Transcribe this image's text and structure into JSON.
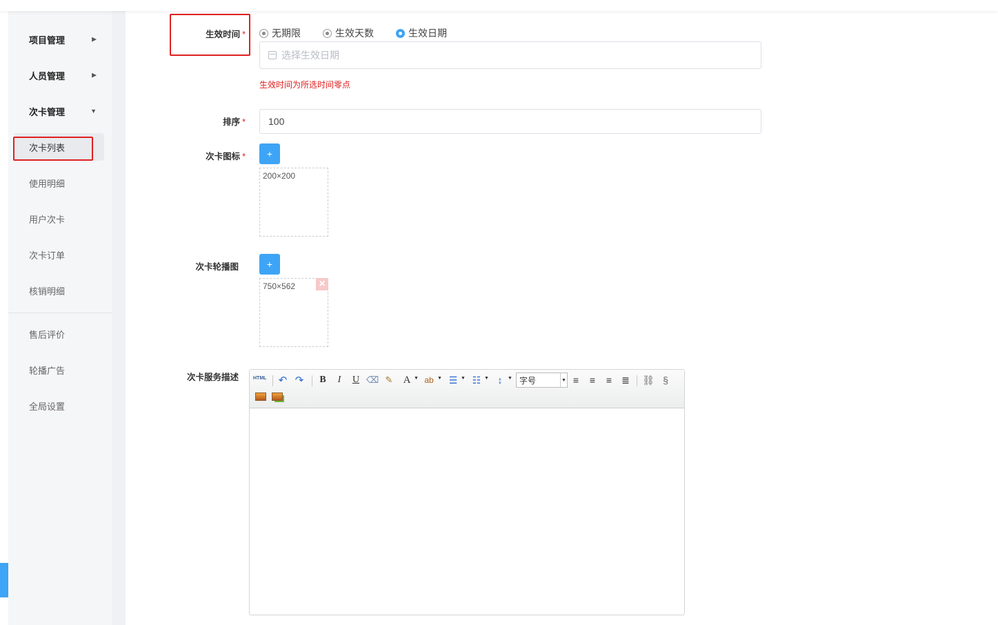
{
  "sidebar": {
    "groups": [
      {
        "label": "项目管理",
        "caret": "▶"
      },
      {
        "label": "人员管理",
        "caret": "▶"
      },
      {
        "label": "次卡管理",
        "caret": "▼"
      }
    ],
    "subitems": [
      "次卡列表",
      "使用明细",
      "用户次卡",
      "次卡订单",
      "核销明细"
    ],
    "items": [
      "售后评价",
      "轮播广告",
      "全局设置"
    ]
  },
  "form": {
    "effective_time": {
      "label": "生效时间",
      "required_mark": "*",
      "options": [
        "无期限",
        "生效天数",
        "生效日期"
      ],
      "selected": "生效日期",
      "date_placeholder": "选择生效日期",
      "hint": "生效时间为所选时间零点"
    },
    "sort": {
      "label": "排序",
      "required_mark": "*",
      "value": "100"
    },
    "icon": {
      "label": "次卡图标",
      "required_mark": "*",
      "add_label": "+",
      "size_hint": "200×200"
    },
    "carousel": {
      "label": "次卡轮播图",
      "add_label": "+",
      "size_hint": "750×562",
      "delete_label": "×"
    },
    "description": {
      "label": "次卡服务描述",
      "toolbar": {
        "html": "HTML",
        "bold": "B",
        "italic": "I",
        "underline": "U",
        "font_color": "A",
        "font_size": "字号"
      }
    }
  },
  "colors": {
    "accent": "#3ea4f5",
    "required": "#e02020",
    "highlight_box": "#e02020"
  }
}
